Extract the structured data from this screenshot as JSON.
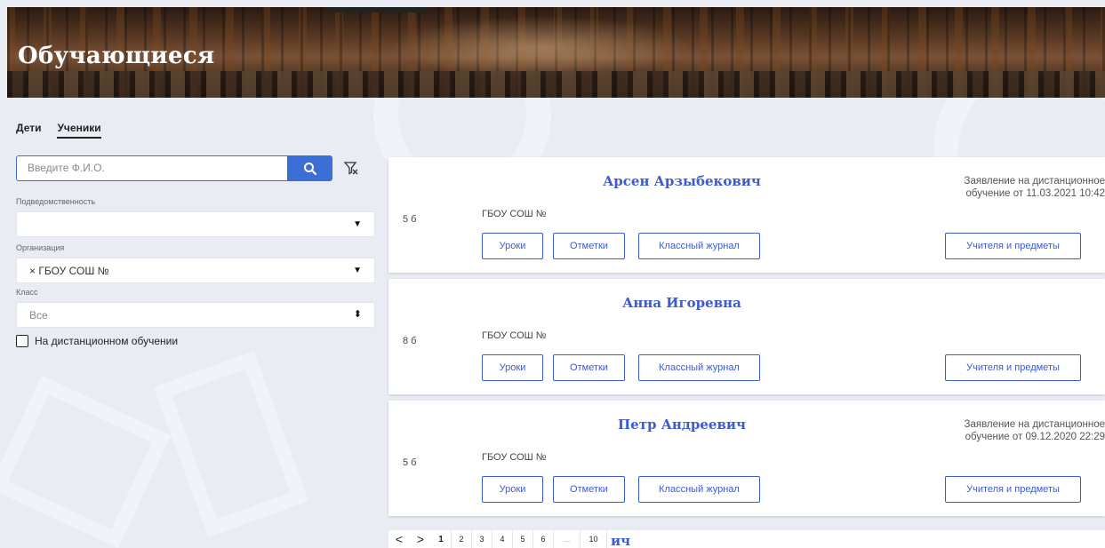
{
  "header": {
    "title": "Обучающиеся"
  },
  "tabs": [
    {
      "label": "Дети"
    },
    {
      "label": "Ученики"
    }
  ],
  "filters": {
    "search_placeholder": "Введите Ф.И.О.",
    "subordination_label": "Подведомственность",
    "subordination_value": "",
    "organization_label": "Организация",
    "organization_value": "× ГБОУ СОШ №",
    "class_label": "Класс",
    "class_value": "Все",
    "distance_checkbox_label": "На дистанционном обучении",
    "distance_checked": false
  },
  "students": [
    {
      "name": "Арсен Арзыбекович",
      "grade": "5 б",
      "org": "ГБОУ СОШ №",
      "notice_line1": "Заявление на дистанционное",
      "notice_line2": "обучение от 11.03.2021 10:42"
    },
    {
      "name": "Анна Игоревна",
      "grade": "8 б",
      "org": "ГБОУ СОШ №",
      "notice_line1": "",
      "notice_line2": ""
    },
    {
      "name": "Петр Андреевич",
      "grade": "5 б",
      "org": "ГБОУ СОШ №",
      "notice_line1": "Заявление на дистанционное",
      "notice_line2": "обучение от 09.12.2020 22:29"
    }
  ],
  "buttons": {
    "lessons": "Уроки",
    "marks": "Отметки",
    "class_journal": "Классный журнал",
    "teachers": "Учителя и предметы"
  },
  "pagination": {
    "prev": "<",
    "next": ">",
    "pages": [
      "1",
      "2",
      "3",
      "4",
      "5",
      "6",
      "...",
      "10"
    ],
    "current": "1",
    "trailing_text": "ич"
  },
  "colors": {
    "accent": "#3d5bd0",
    "search_button": "#3c6fd6"
  }
}
